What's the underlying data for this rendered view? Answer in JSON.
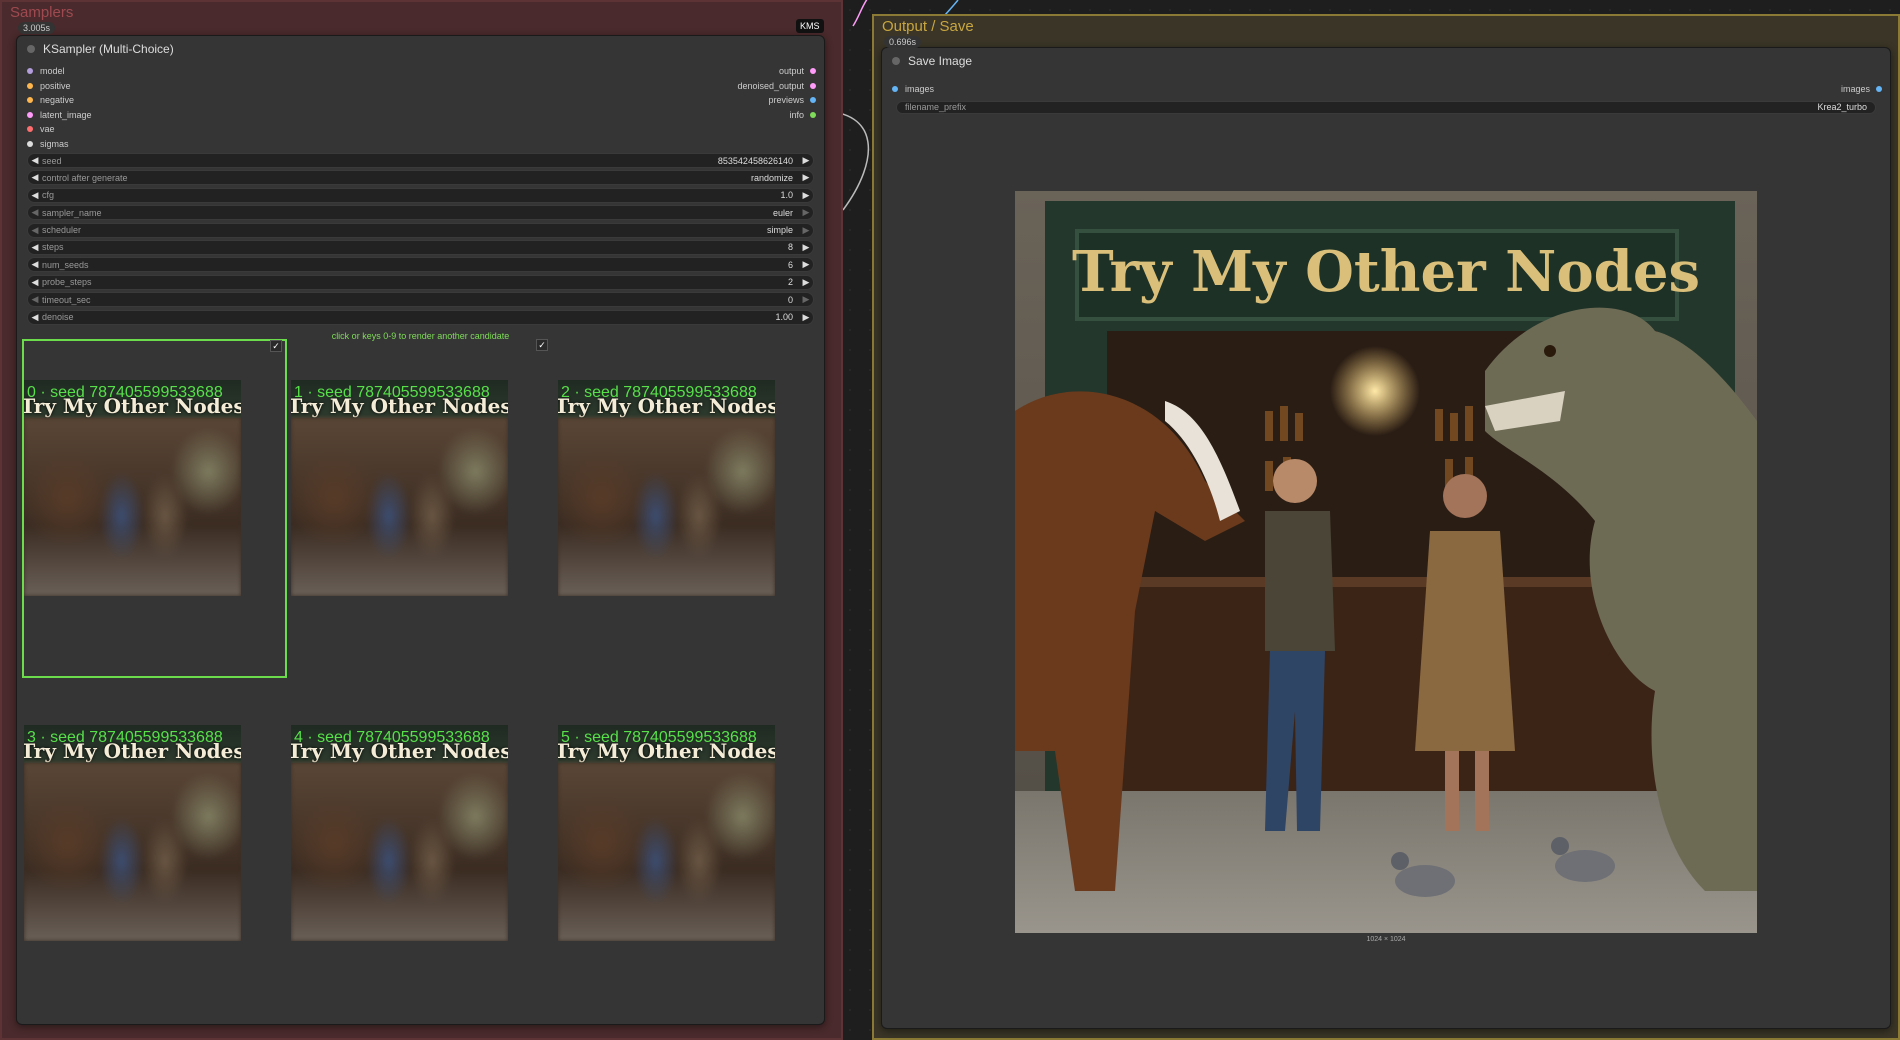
{
  "groups": {
    "samplers": "Samplers",
    "output": "Output / Save"
  },
  "ksampler": {
    "title": "KSampler (Multi-Choice)",
    "exec_time": "3.005s",
    "badge": "KMS",
    "inputs": [
      {
        "label": "model",
        "color": "#b39ddb"
      },
      {
        "label": "positive",
        "color": "#ffb74d"
      },
      {
        "label": "negative",
        "color": "#ffb74d"
      },
      {
        "label": "latent_image",
        "color": "#ff9cf9"
      },
      {
        "label": "vae",
        "color": "#ff6e6e"
      },
      {
        "label": "sigmas",
        "color": "#dddddd"
      }
    ],
    "outputs": [
      {
        "label": "output",
        "color": "#ff9cf9"
      },
      {
        "label": "denoised_output",
        "color": "#ff9cf9"
      },
      {
        "label": "previews",
        "color": "#64b5f6"
      },
      {
        "label": "info",
        "color": "#7fdc5a"
      }
    ],
    "widgets": [
      {
        "label": "seed",
        "value": "853542458626140",
        "dim": false
      },
      {
        "label": "control after generate",
        "value": "randomize",
        "dim": false
      },
      {
        "label": "cfg",
        "value": "1.0",
        "dim": false
      },
      {
        "label": "sampler_name",
        "value": "euler",
        "dim": true
      },
      {
        "label": "scheduler",
        "value": "simple",
        "dim": true
      },
      {
        "label": "steps",
        "value": "8",
        "dim": false
      },
      {
        "label": "num_seeds",
        "value": "6",
        "dim": false
      },
      {
        "label": "probe_steps",
        "value": "2",
        "dim": false
      },
      {
        "label": "timeout_sec",
        "value": "0",
        "dim": true
      },
      {
        "label": "denoise",
        "value": "1.00",
        "dim": false
      }
    ],
    "hint": "click or keys 0-9 to render another candidate",
    "check_mark": "✓",
    "candidates": [
      {
        "caption": "0 · seed 787405599533688",
        "sign": "Try My Other Nodes"
      },
      {
        "caption": "1 · seed 787405599533688",
        "sign": "Try My Other Nodes"
      },
      {
        "caption": "2 · seed 787405599533688",
        "sign": "Try My Other Nodes"
      },
      {
        "caption": "3 · seed 787405599533688",
        "sign": "Try My Other Nodes"
      },
      {
        "caption": "4 · seed 787405599533688",
        "sign": "Try My Other Nodes"
      },
      {
        "caption": "5 · seed 787405599533688",
        "sign": "Try My Other Nodes"
      }
    ],
    "selected_index": 0
  },
  "save": {
    "title": "Save Image",
    "exec_time": "0.696s",
    "input": "images",
    "output": "images",
    "filename_label": "filename_prefix",
    "filename_value": "Krea2_turbo",
    "image_sign": "Try My Other Nodes",
    "dims": "1024 × 1024"
  },
  "colors": {
    "wire_pink": "#ff9cf9",
    "wire_blue": "#64b5f6",
    "wire_red": "#ff6e6e",
    "wire_white": "#dddddd"
  }
}
